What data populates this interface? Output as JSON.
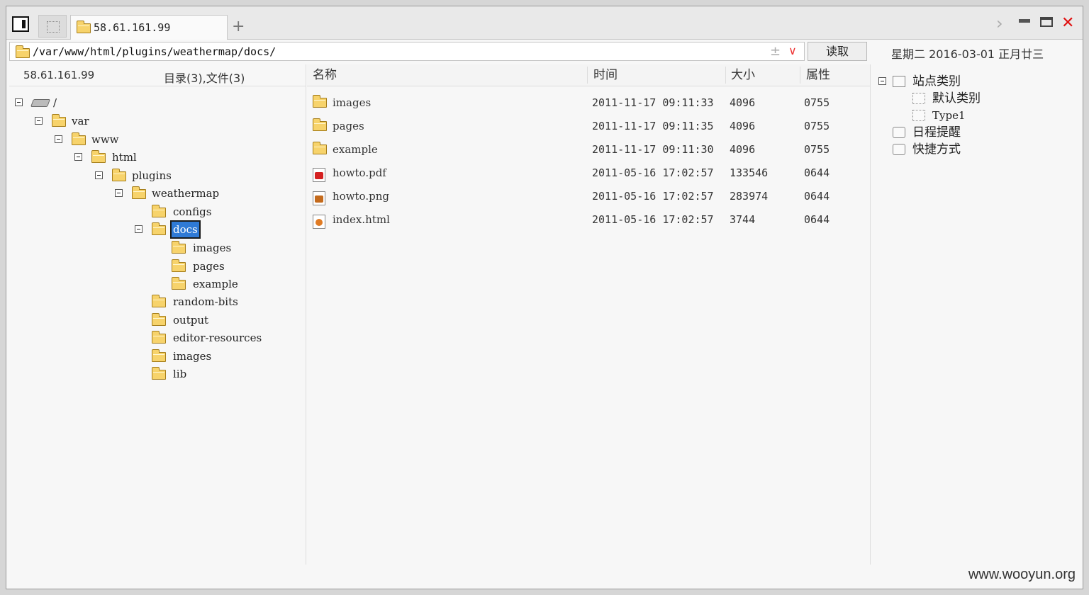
{
  "tabbar": {
    "active_tab_label": "58.61.161.99",
    "add_tab_label": "+"
  },
  "address": {
    "path": "/var/www/html/plugins/weathermap/docs/",
    "read_label": "读取",
    "date": "星期二 2016-03-01 正月廿三"
  },
  "tree": {
    "server_ip": "58.61.161.99",
    "summary": "目录(3),文件(3)",
    "nodes": [
      {
        "label": "/"
      },
      {
        "label": "var"
      },
      {
        "label": "www"
      },
      {
        "label": "html"
      },
      {
        "label": "plugins"
      },
      {
        "label": "weathermap"
      },
      {
        "label": "configs"
      },
      {
        "label": "docs"
      },
      {
        "label": "images"
      },
      {
        "label": "pages"
      },
      {
        "label": "example"
      },
      {
        "label": "random-bits"
      },
      {
        "label": "output"
      },
      {
        "label": "editor-resources"
      },
      {
        "label": "images"
      },
      {
        "label": "lib"
      }
    ]
  },
  "filelist": {
    "columns": {
      "name": "名称",
      "time": "时间",
      "size": "大小",
      "attr": "属性"
    },
    "rows": [
      {
        "name": "images",
        "time": "2011-11-17 09:11:33",
        "size": "4096",
        "attr": "0755",
        "icon": "folder-icon"
      },
      {
        "name": "pages",
        "time": "2011-11-17 09:11:35",
        "size": "4096",
        "attr": "0755",
        "icon": "folder-icon"
      },
      {
        "name": "example",
        "time": "2011-11-17 09:11:30",
        "size": "4096",
        "attr": "0755",
        "icon": "folder-icon"
      },
      {
        "name": "howto.pdf",
        "time": "2011-05-16 17:02:57",
        "size": "133546",
        "attr": "0644",
        "icon": "pdf-icon"
      },
      {
        "name": "howto.png",
        "time": "2011-05-16 17:02:57",
        "size": "283974",
        "attr": "0644",
        "icon": "image-icon"
      },
      {
        "name": "index.html",
        "time": "2011-05-16 17:02:57",
        "size": "3744",
        "attr": "0644",
        "icon": "html-icon"
      }
    ]
  },
  "right_panel": {
    "site_category": "站点类别",
    "default_category": "默认类别",
    "type1": "Type1",
    "schedule": "日程提醒",
    "shortcuts": "快捷方式"
  },
  "watermark": "www.wooyun.org",
  "colors": {
    "selection": "#2f7ad6",
    "close": "#e01010",
    "folder": "#f7d36b"
  }
}
